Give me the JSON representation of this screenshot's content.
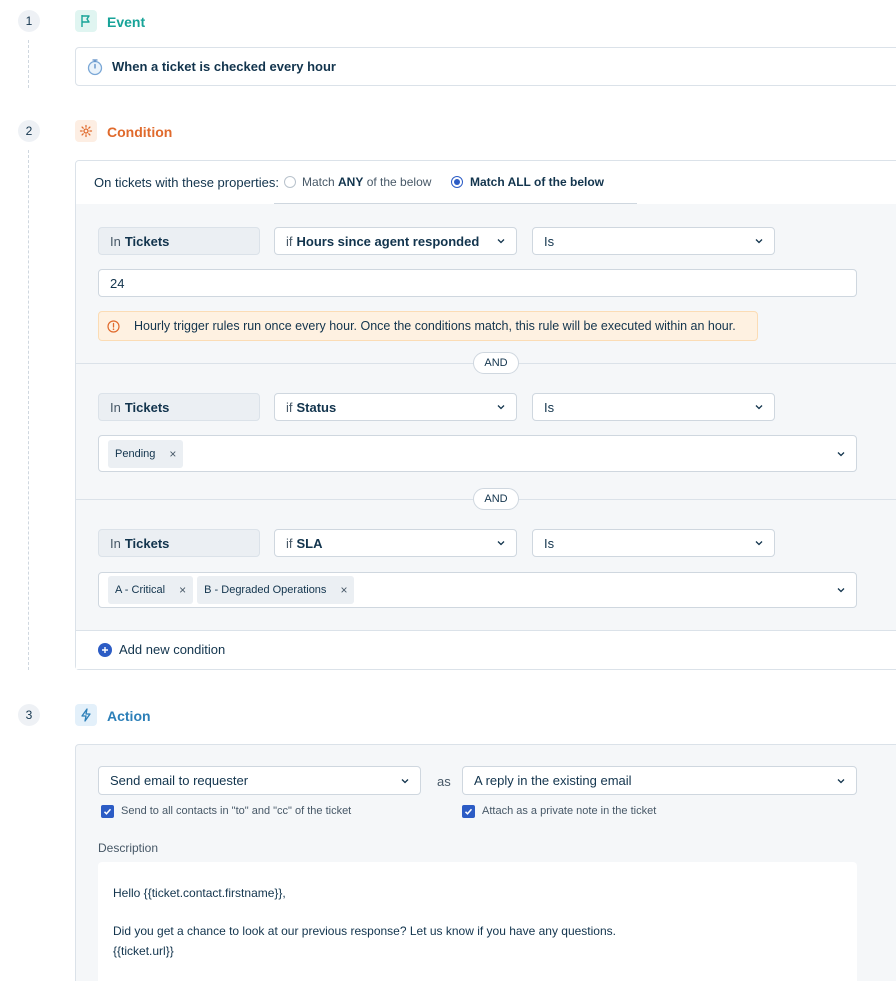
{
  "steps": {
    "event": {
      "number": "1",
      "title": "Event",
      "color": "#17a398"
    },
    "condition": {
      "number": "2",
      "title": "Condition",
      "color": "#e06a2c"
    },
    "action": {
      "number": "3",
      "title": "Action",
      "color": "#2c7fb8"
    }
  },
  "event": {
    "trigger_text": "When a ticket is checked every hour"
  },
  "condition": {
    "intro": "On tickets with these properties:",
    "match_any": {
      "prefix": "Match ",
      "strong": "ANY",
      "suffix": " of the below"
    },
    "match_all": {
      "prefix": "Match ",
      "strong": "ALL",
      "suffix": " of the below"
    },
    "selected_match": "all",
    "and_label": "AND",
    "blocks": [
      {
        "in_prefix": "In",
        "in_value": "Tickets",
        "if_prefix": "if",
        "field": "Hours since agent responded",
        "operator": "Is",
        "value": "24",
        "info": "Hourly trigger rules run once every hour. Once the conditions match, this rule will be executed within an hour."
      },
      {
        "in_prefix": "In",
        "in_value": "Tickets",
        "if_prefix": "if",
        "field": "Status",
        "operator": "Is",
        "tags": [
          "Pending"
        ]
      },
      {
        "in_prefix": "In",
        "in_value": "Tickets",
        "if_prefix": "if",
        "field": "SLA",
        "operator": "Is",
        "tags": [
          "A - Critical",
          "B - Degraded Operations"
        ]
      }
    ],
    "add_label": "Add new condition"
  },
  "action": {
    "action_type": "Send email to requester",
    "as_label": "as",
    "reply_mode": "A reply in the existing email",
    "check_contacts": "Send to all contacts in \"to\" and \"cc\" of the ticket",
    "check_private_note": "Attach as a private note in the ticket",
    "description_label": "Description",
    "body_line1": "Hello {{ticket.contact.firstname}},",
    "body_line2": "Did you get a chance to look at our previous response? Let us know if you have any questions.",
    "body_line3": "{{ticket.url}}"
  },
  "colors": {
    "primary": "#2c5cc5",
    "warning_bg": "#fef1e1",
    "warning_border": "#fbdcb5",
    "panel_bg": "#f5f7f9"
  }
}
